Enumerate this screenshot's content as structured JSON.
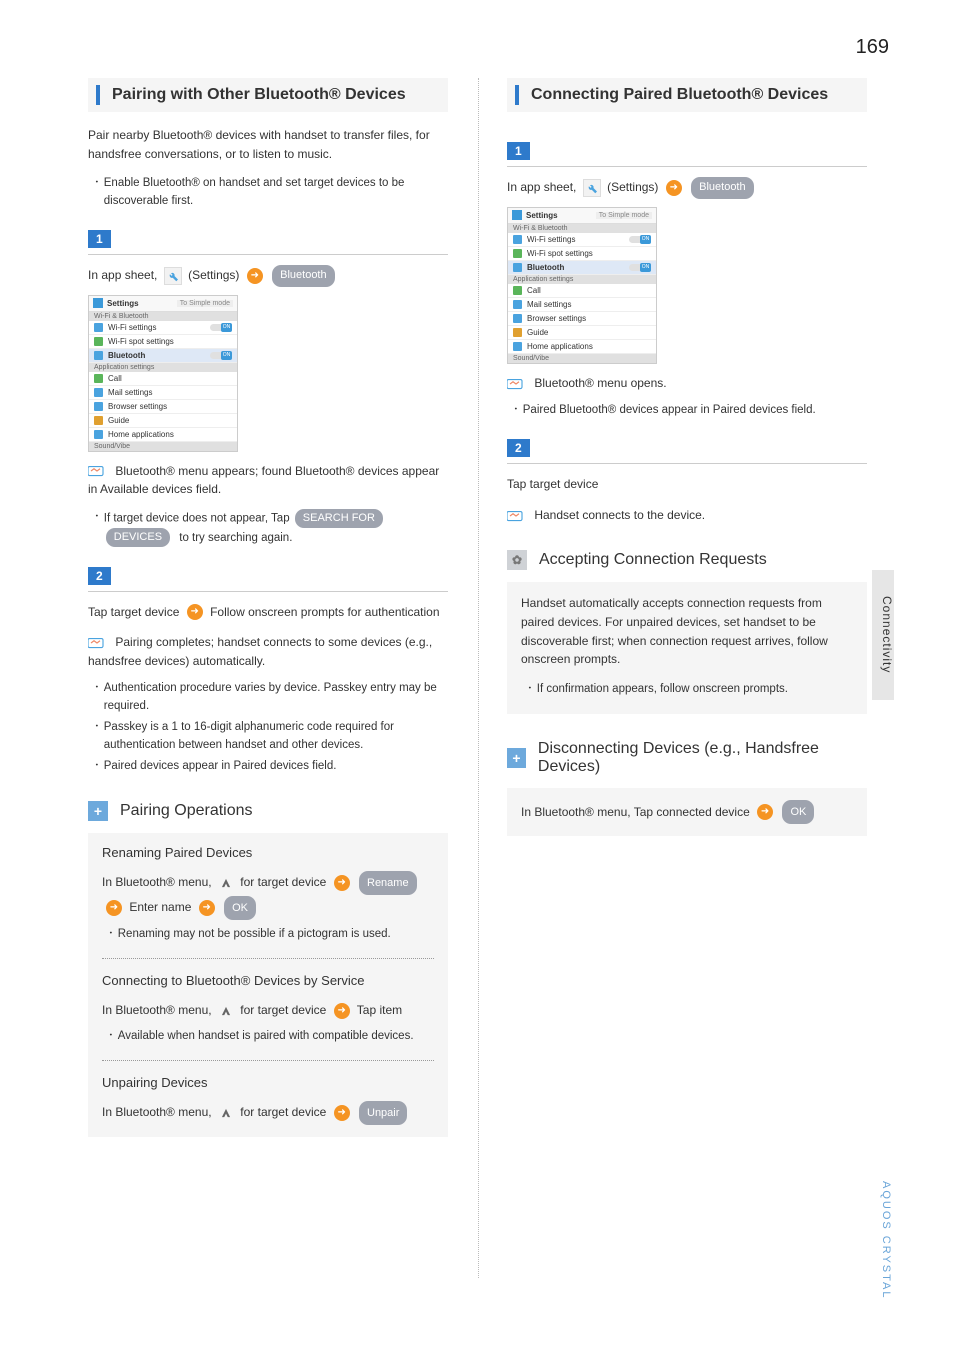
{
  "page_number": "169",
  "side_tab": "Connectivity",
  "footer_brand": "AQUOS CRYSTAL",
  "left": {
    "section_title": "Pairing with Other Bluetooth® Devices",
    "intro": "Pair nearby Bluetooth® devices with handset to transfer files, for handsfree conversations, or to listen to music.",
    "intro_bullet": "Enable Bluetooth® on handset and set target devices to be discoverable first.",
    "step1_badge": "1",
    "step1_prefix": "In app sheet,",
    "step1_settings": "(Settings)",
    "step1_bluetooth": "Bluetooth",
    "note1": "Bluetooth® menu appears; found Bluetooth® devices appear in Available devices field.",
    "note1_bullet_a": "If target device does not appear, Tap",
    "note1_pill1": "SEARCH FOR",
    "note1_pill2": "DEVICES",
    "note1_bullet_b": "to try searching again.",
    "step2_badge": "2",
    "step2_text_a": "Tap target device",
    "step2_text_b": "Follow onscreen prompts for authentication",
    "note2": "Pairing completes; handset connects to some devices (e.g., handsfree devices) automatically.",
    "note2_b1": "Authentication procedure varies by device. Passkey entry may be required.",
    "note2_b2": "Passkey is a 1 to 16-digit alphanumeric code required for authentication between handset and other devices.",
    "note2_b3": "Paired devices appear in Paired devices field.",
    "ops_title": "Pairing Operations",
    "ops1_title": "Renaming Paired Devices",
    "ops1_a": "In Bluetooth® menu,",
    "ops1_b": "for target device",
    "ops1_pill_rename": "Rename",
    "ops1_c": "Enter name",
    "ops1_pill_ok": "OK",
    "ops1_bullet": "Renaming may not be possible if a pictogram is used.",
    "ops2_title": "Connecting to Bluetooth® Devices by Service",
    "ops2_a": "In Bluetooth® menu,",
    "ops2_b": "for target device",
    "ops2_c": "Tap item",
    "ops2_bullet": "Available when handset is paired with compatible devices.",
    "ops3_title": "Unpairing Devices",
    "ops3_a": "In Bluetooth® menu,",
    "ops3_b": "for target device",
    "ops3_pill_unpair": "Unpair"
  },
  "right": {
    "section_title": "Connecting Paired Bluetooth® Devices",
    "step1_badge": "1",
    "step1_prefix": "In app sheet,",
    "step1_settings": "(Settings)",
    "step1_bluetooth": "Bluetooth",
    "note1": "Bluetooth® menu opens.",
    "note1_bullet": "Paired Bluetooth® devices appear in Paired devices field.",
    "step2_badge": "2",
    "step2_text": "Tap target device",
    "note2": "Handset connects to the device.",
    "acc_title": "Accepting Connection Requests",
    "acc_body": "Handset automatically accepts connection requests from paired devices. For unpaired devices, set handset to be discoverable first; when connection request arrives, follow onscreen prompts.",
    "acc_bullet": "If confirmation appears, follow onscreen prompts.",
    "disc_title": "Disconnecting Devices (e.g., Handsfree Devices)",
    "disc_text": "In Bluetooth® menu, Tap connected device",
    "disc_pill_ok": "OK"
  },
  "mini": {
    "header_title": "Settings",
    "header_simple": "To Simple mode",
    "cat1": "Wi-Fi & Bluetooth",
    "row_wifi": "Wi-Fi settings",
    "row_wifispot": "Wi-Fi spot settings",
    "row_bt": "Bluetooth",
    "toggle_on": "ON",
    "cat2": "Application settings",
    "row_call": "Call",
    "row_mail": "Mail settings",
    "row_browser": "Browser settings",
    "row_guide": "Guide",
    "row_home": "Home applications",
    "cat3": "Sound/Vibe"
  }
}
